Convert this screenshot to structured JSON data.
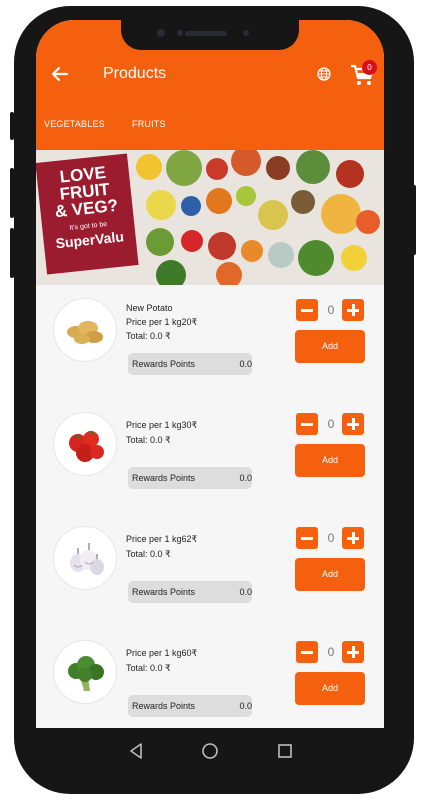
{
  "header": {
    "title": "Products"
  },
  "cart": {
    "count": "0"
  },
  "tabs": [
    {
      "label": "VEGETABLES"
    },
    {
      "label": "FRUITS"
    }
  ],
  "banner": {
    "line1": "LOVE",
    "line2": "FRUIT",
    "line3": "& VEG?",
    "tagline": "It's got to be",
    "brand": "SuperValu"
  },
  "products": [
    {
      "name": "New Potato",
      "price": "Price per 1 kg20₹",
      "total": "Total: 0.0 ₹",
      "rewards_label": "Rewards Points",
      "rewards_value": "0.0",
      "quantity": "0",
      "add_label": "Add"
    },
    {
      "name": "",
      "price": "Price per 1 kg30₹",
      "total": "Total: 0.0 ₹",
      "rewards_label": "Rewards Points",
      "rewards_value": "0.0",
      "quantity": "0",
      "add_label": "Add"
    },
    {
      "name": "",
      "price": "Price per 1 kg62₹",
      "total": "Total: 0.0 ₹",
      "rewards_label": "Rewards Points",
      "rewards_value": "0.0",
      "quantity": "0",
      "add_label": "Add"
    },
    {
      "name": "",
      "price": "Price per 1 kg60₹",
      "total": "Total: 0.0 ₹",
      "rewards_label": "Rewards Points",
      "rewards_value": "0.0",
      "quantity": "0",
      "add_label": "Add"
    }
  ],
  "colors": {
    "accent": "#f4600e",
    "badge": "#d90f1c",
    "promo": "#9b1c2e"
  },
  "icons": {
    "back": "arrow-left-icon",
    "language": "globe-icon",
    "cart": "cart-icon",
    "minus": "minus-icon",
    "plus": "plus-icon"
  }
}
